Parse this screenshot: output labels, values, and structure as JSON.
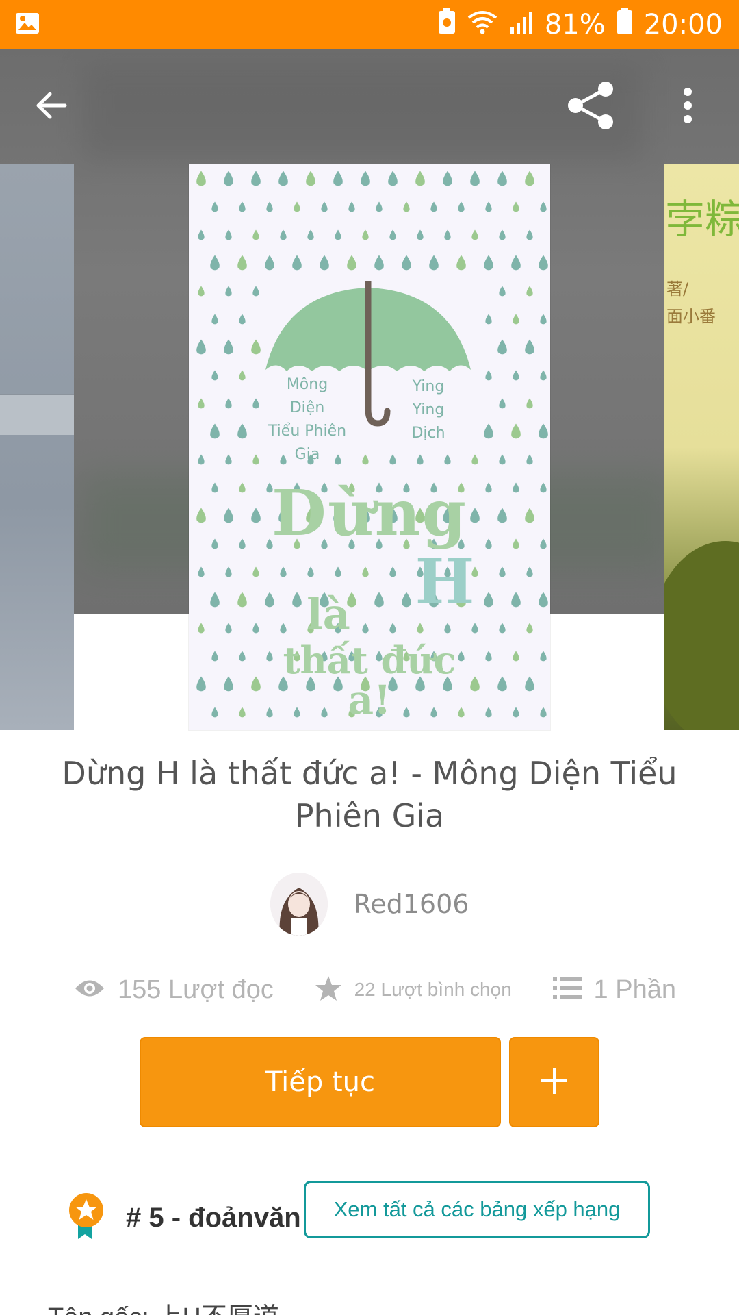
{
  "status_bar": {
    "battery_percent": "81%",
    "time": "20:00",
    "icons": [
      "image-icon",
      "recycle-icon",
      "wifi-icon",
      "signal-icon",
      "battery-icon"
    ]
  },
  "toolbar": {
    "back_icon": "arrow-left-icon",
    "share_icon": "share-icon",
    "more_icon": "more-vertical-icon"
  },
  "cover": {
    "author_left": [
      "Mông",
      "Diện",
      "Tiểu Phiên",
      "Gia"
    ],
    "translator_right": [
      "Ying",
      "Ying",
      "Dịch"
    ],
    "title_line1": "Dừng",
    "title_h": "H",
    "title_line2": "là",
    "title_line3": "thất đức",
    "title_line4": "a!"
  },
  "book": {
    "title": "Dừng H là thất đức a! - Mông Diện Tiểu Phiên Gia",
    "author": "Red1606"
  },
  "stats": {
    "reads": "155 Lượt đọc",
    "votes": "22 Lượt bình chọn",
    "parts": "1 Phần"
  },
  "actions": {
    "continue_label": "Tiếp tục",
    "add_label": "+"
  },
  "ranking": {
    "rank_text": "# 5 - đoảnvăn",
    "see_all_label": "Xem tất cả các bảng xếp hạng"
  },
  "original_title": "Tên gốc: 上H不厚道",
  "colors": {
    "status_bar": "#ff8a00",
    "accent_orange": "#f7960f",
    "teal": "#13999a",
    "cover_green": "#8fc79b"
  }
}
